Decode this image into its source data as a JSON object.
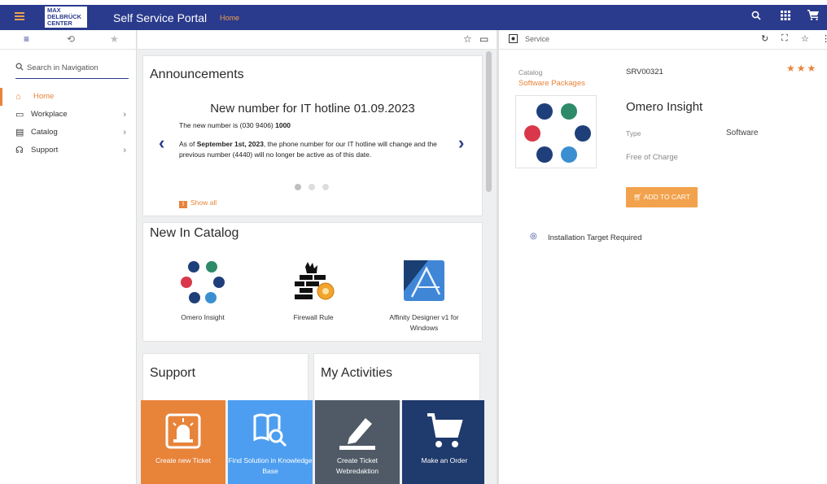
{
  "topbar": {
    "logo_lines": [
      "MAX",
      "DELBRÜCK",
      "CENTER"
    ],
    "title": "Self Service Portal",
    "breadcrumb": "Home"
  },
  "sidebar": {
    "search_placeholder": "Search in Navigation",
    "items": [
      {
        "label": "Home",
        "icon": "home-icon",
        "active": true
      },
      {
        "label": "Workplace",
        "icon": "laptop-icon"
      },
      {
        "label": "Catalog",
        "icon": "catalog-icon"
      },
      {
        "label": "Support",
        "icon": "headset-icon"
      }
    ]
  },
  "announcements": {
    "title": "Announcements",
    "headline": "New number for IT hotline 01.09.2023",
    "line1_prefix": "The new number is (030 9406) ",
    "line1_bold": "1000",
    "line2_prefix": "As of ",
    "line2_bold": "September 1st, 2023",
    "line2_rest": ", the phone number for our IT hotline will change and the previous number (4440) will no longer be active as of this date.",
    "show_all": "Show all",
    "slide_count": 3,
    "active_slide": 1
  },
  "catalog": {
    "title": "New In Catalog",
    "items": [
      {
        "label": "Omero Insight"
      },
      {
        "label": "Firewall Rule"
      },
      {
        "label": "Affinity Designer v1 for Windows"
      }
    ]
  },
  "support": {
    "title": "Support"
  },
  "activities": {
    "title": "My Activities"
  },
  "tiles": [
    {
      "label": "Create new Ticket",
      "color": "#e8833a"
    },
    {
      "label": "Find Solution in Knowledge Base",
      "color": "#4d9ef0"
    },
    {
      "label": "Create Ticket Webredaktion",
      "color": "#4f5a66"
    },
    {
      "label": "Make an Order",
      "color": "#1f3a6c"
    }
  ],
  "service": {
    "panel_title": "Service",
    "catalog_label": "Catalog",
    "catalog_value": "Software Packages",
    "id": "SRV00321",
    "rating_stars": 3,
    "name": "Omero Insight",
    "type_label": "Type",
    "type_value": "Software",
    "price": "Free of Charge",
    "add_to_cart": "ADD TO CART",
    "installation_note": "Installation Target Required"
  },
  "colors": {
    "brand": "#2a3a8c",
    "accent": "#e8833a",
    "dot_navy": "#1f3f7a",
    "dot_green": "#2e8b6a",
    "dot_red": "#d9384a",
    "dot_blue": "#3b8fd1"
  }
}
